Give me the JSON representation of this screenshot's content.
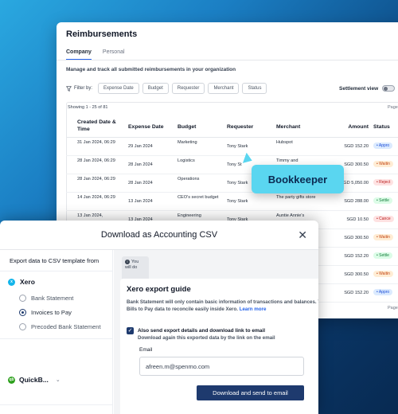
{
  "reimbursements": {
    "title": "Reimbursements",
    "tabs": [
      {
        "label": "Company"
      },
      {
        "label": "Personal"
      }
    ],
    "description": "Manage and track all submitted reimbursements in your organization",
    "filter_label": "Filter by:",
    "filters": [
      "Expense Date",
      "Budget",
      "Requester",
      "Merchant",
      "Status"
    ],
    "settlement_view": "Settlement view",
    "showing": "Showing 1 - 25 of 81",
    "page_hint": "Page",
    "columns": {
      "created": "Created Date & Time",
      "expense": "Expense Date",
      "budget": "Budget",
      "requester": "Requester",
      "merchant": "Merchant",
      "amount": "Amount",
      "status": "Status"
    },
    "rows": [
      {
        "created": "31 Jan 2024, 06:29",
        "expense": "29 Jan 2024",
        "budget": "Marketing",
        "requester": "Tony Stark",
        "merchant": "Hubspot",
        "amount": "SGD 152.20",
        "status": "Appro",
        "status_color": "blue"
      },
      {
        "created": "28 Jan 2024, 06:29",
        "expense": "28 Jan 2024",
        "budget": "Logistics",
        "requester": "Tony St",
        "merchant": "Timmy and",
        "amount": "SGD 300.50",
        "status": "Waitin",
        "status_color": "orange"
      },
      {
        "created": "28 Jan 2024, 06:29",
        "expense": "28 Jan 2024",
        "budget": "Operations",
        "requester": "Tony Stark",
        "merchant": "",
        "amount": "SGD 5,050.00",
        "status": "Reject",
        "status_color": "red"
      },
      {
        "created": "14 Jan 2024, 06:29",
        "expense": "13 Jan 2024",
        "budget": "CEO's secret budget",
        "requester": "Tony Stark",
        "merchant": "The party gifts store",
        "amount": "SGD 288.00",
        "status": "Settle",
        "status_color": "green"
      },
      {
        "created": "13 Jan 2024,",
        "expense": "13 Jan 2024",
        "budget": "Engineering",
        "requester": "Tony Stark",
        "merchant": "Auntie Annie's",
        "amount": "SGD 10.50",
        "status": "Cance",
        "status_color": "red"
      },
      {
        "created": "",
        "expense": "",
        "budget": "",
        "requester": "",
        "merchant": "",
        "amount": "SGD 300.50",
        "status": "Waitin",
        "status_color": "orange"
      },
      {
        "created": "",
        "expense": "",
        "budget": "",
        "requester": "",
        "merchant": "",
        "amount": "SGD 152.20",
        "status": "Settle",
        "status_color": "green"
      },
      {
        "created": "",
        "expense": "",
        "budget": "",
        "requester": "",
        "merchant": "",
        "amount": "SGD 300.50",
        "status": "Waitin",
        "status_color": "orange"
      },
      {
        "created": "",
        "expense": "",
        "budget": "",
        "requester": "",
        "merchant": "",
        "amount": "SGD 152.20",
        "status": "Appro",
        "status_color": "blue"
      }
    ]
  },
  "badge": {
    "label": "Bookkeeper"
  },
  "dialog": {
    "title": "Download as Accounting CSV",
    "close": "✕",
    "sidebar_title": "Export data to CSV template from",
    "providers": [
      {
        "label": "Xero",
        "logo": "xero"
      },
      {
        "label": "QuickB...",
        "logo": "qb"
      }
    ],
    "options": [
      "Bank Statement",
      "Invoices to Pay",
      "Precoded Bank Statement"
    ],
    "selected_option": "Invoices to Pay",
    "notice": "You will do",
    "guide_title": "Xero export guide",
    "guide_text": "Bank Statement will only contain basic information of transactions and balances. You can also export Bills to Pay data to reconcile easily inside Xero.",
    "learn_more": "Learn more",
    "checkbox_label": "Also send export details and download link to email",
    "checkbox_sub": "Download again this exported data by the link on the email",
    "email_label": "Email",
    "email_value": "afreen.m@spenmo.com",
    "submit": "Download and send to email"
  }
}
